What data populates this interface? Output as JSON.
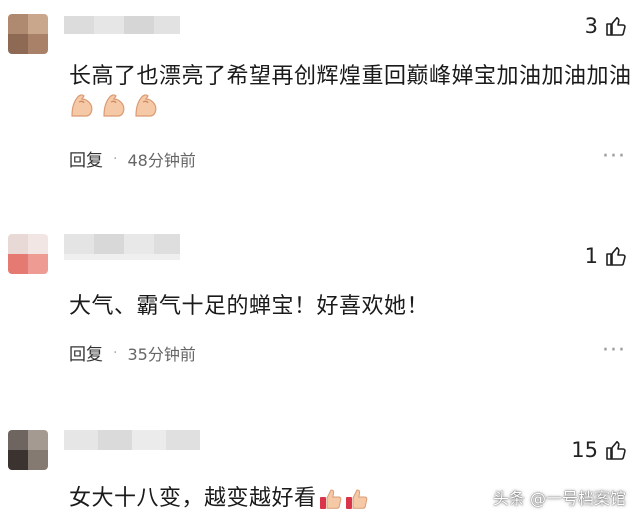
{
  "comments": [
    {
      "text": "长高了也漂亮了希望再创辉煌重回巅峰婵宝加油加油加油",
      "likes": "3",
      "reply_label": "回复",
      "separator": "·",
      "time": "48分钟前",
      "emojis": [
        "flexed-biceps",
        "flexed-biceps",
        "flexed-biceps"
      ]
    },
    {
      "text": "大气、霸气十足的蝉宝！好喜欢她！",
      "likes": "1",
      "reply_label": "回复",
      "separator": "·",
      "time": "35分钟前"
    },
    {
      "text": "女大十八变，越变越好看",
      "likes": "15",
      "emojis": [
        "thumbs-up",
        "thumbs-up"
      ]
    }
  ],
  "more_label": "···",
  "watermark": "头条 @一号档案馆",
  "colors": {
    "text": "#1a1a1a",
    "meta": "#666666",
    "skin": "#f6c9a6"
  }
}
